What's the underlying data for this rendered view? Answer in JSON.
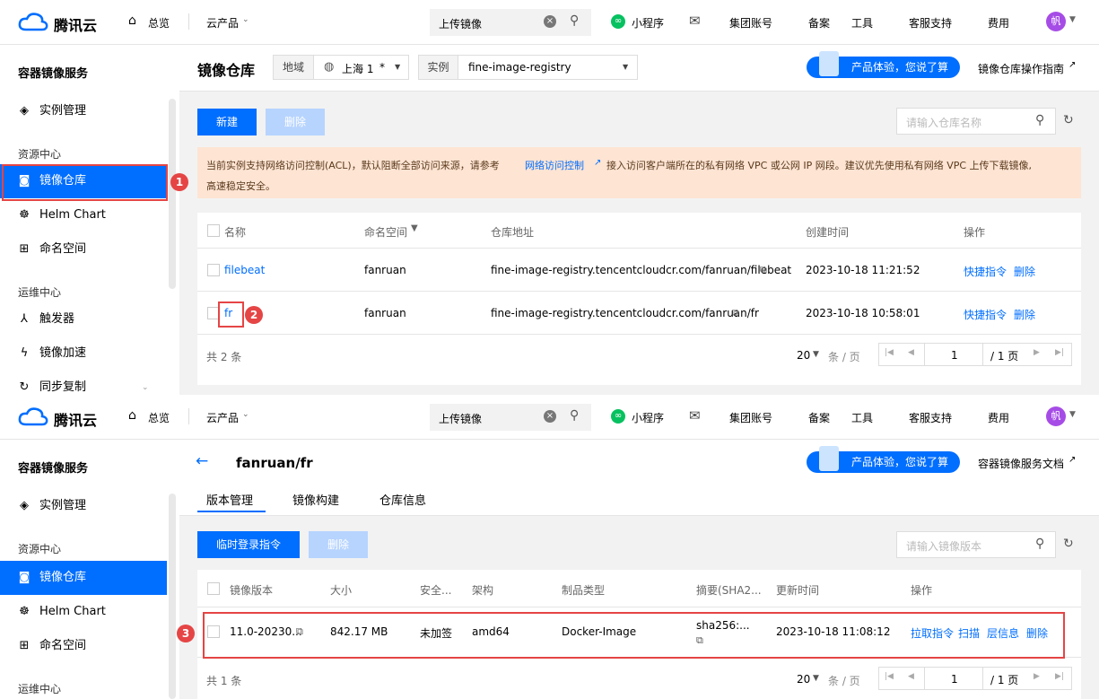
{
  "topnav": {
    "brand": "腾讯云",
    "overview": "总览",
    "products": "云产品",
    "search_value": "上传镜像",
    "mini_program": "小程序",
    "group_account": "集团账号",
    "record": "备案",
    "tools": "工具",
    "support": "客服支持",
    "billing": "费用",
    "avatar": "帆"
  },
  "sidebar": {
    "title": "容器镜像服务",
    "instance_mgmt": "实例管理",
    "group_resource": "资源中心",
    "image_repo": "镜像仓库",
    "helm_chart": "Helm Chart",
    "namespace": "命名空间",
    "group_ops": "运维中心",
    "trigger": "触发器",
    "accel": "镜像加速",
    "sync": "同步复制"
  },
  "panel1": {
    "title": "镜像仓库",
    "region_label": "地域",
    "region_value": "上海 1",
    "region_star": "*",
    "instance_label": "实例",
    "instance_value": "fine-image-registry",
    "promo": "产品体验，您说了算",
    "guide_link": "镜像仓库操作指南",
    "new_btn": "新建",
    "delete_btn": "删除",
    "search_placeholder": "请输入仓库名称",
    "notice_part1": "当前实例支持网络访问控制(ACL)，默认阻断全部访问来源，请参考",
    "notice_link": "网络访问控制",
    "notice_part2": "接入访问客户端所在的私有网络 VPC 或公网 IP 网段。建议优先使用私有网络 VPC 上传下载镜像,",
    "notice_part3": "高速稳定安全。",
    "columns": [
      "名称",
      "命名空间",
      "仓库地址",
      "创建时间",
      "操作"
    ],
    "rows": [
      {
        "name": "filebeat",
        "namespace": "fanruan",
        "address": "fine-image-registry.tencentcloudcr.com/fanruan/filebeat",
        "created": "2023-10-18 11:21:52",
        "op1": "快捷指令",
        "op2": "删除"
      },
      {
        "name": "fr",
        "namespace": "fanruan",
        "address": "fine-image-registry.tencentcloudcr.com/fanruan/fr",
        "created": "2023-10-18 10:58:01",
        "op1": "快捷指令",
        "op2": "删除"
      }
    ],
    "total": "共 2 条",
    "page_size": "20",
    "per_page": "条 / 页",
    "page_no": "1",
    "page_total": "/ 1 页",
    "badge1": "1",
    "badge2": "2"
  },
  "panel2": {
    "title": "fanruan/fr",
    "promo": "产品体验，您说了算",
    "doc_link": "容器镜像服务文档",
    "tabs": [
      "版本管理",
      "镜像构建",
      "仓库信息"
    ],
    "login_btn": "临时登录指令",
    "delete_btn": "删除",
    "search_placeholder": "请输入镜像版本",
    "columns": [
      "镜像版本",
      "大小",
      "安全...",
      "架构",
      "制品类型",
      "摘要(SHA2...",
      "更新时间",
      "操作"
    ],
    "row": {
      "version": "11.0-20230...",
      "size": "842.17 MB",
      "security": "未加签",
      "arch": "amd64",
      "type": "Docker-Image",
      "digest": "sha256:...",
      "updated": "2023-10-18 11:08:12",
      "op1": "拉取指令",
      "op2": "扫描",
      "op3": "层信息",
      "op4": "删除"
    },
    "total": "共 1 条",
    "page_size": "20",
    "per_page": "条 / 页",
    "page_no": "1",
    "page_total": "/ 1 页",
    "badge3": "3"
  }
}
